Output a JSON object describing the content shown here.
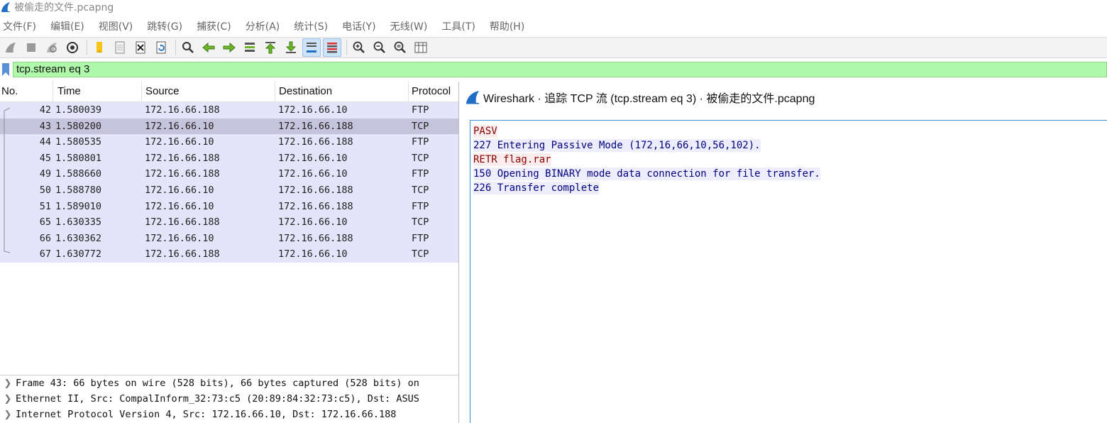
{
  "window": {
    "title": "被偷走的文件.pcapng"
  },
  "menu": [
    "文件(F)",
    "编辑(E)",
    "视图(V)",
    "跳转(G)",
    "捕获(C)",
    "分析(A)",
    "统计(S)",
    "电话(Y)",
    "无线(W)",
    "工具(T)",
    "帮助(H)"
  ],
  "toolbar": {
    "icons": [
      "start-capture-icon",
      "stop-capture-icon",
      "restart-capture-icon",
      "capture-options-icon",
      "open-file-icon",
      "save-file-icon",
      "close-file-icon",
      "reload-file-icon",
      "find-packet-icon",
      "go-back-icon",
      "go-forward-icon",
      "go-to-packet-icon",
      "go-first-icon",
      "go-last-icon",
      "auto-scroll-icon",
      "colorize-icon",
      "zoom-in-icon",
      "zoom-out-icon",
      "zoom-reset-icon",
      "resize-columns-icon"
    ]
  },
  "filter": {
    "value": "tcp.stream eq 3",
    "color": "#aff9aa"
  },
  "packet_list": {
    "columns": [
      "No.",
      "Time",
      "Source",
      "Destination",
      "Protocol"
    ],
    "rows": [
      {
        "no": "42",
        "time": "1.580039",
        "src": "172.16.66.188",
        "dst": "172.16.66.10",
        "proto": "FTP"
      },
      {
        "no": "43",
        "time": "1.580200",
        "src": "172.16.66.10",
        "dst": "172.16.66.188",
        "proto": "TCP"
      },
      {
        "no": "44",
        "time": "1.580535",
        "src": "172.16.66.10",
        "dst": "172.16.66.188",
        "proto": "FTP"
      },
      {
        "no": "45",
        "time": "1.580801",
        "src": "172.16.66.188",
        "dst": "172.16.66.10",
        "proto": "TCP"
      },
      {
        "no": "49",
        "time": "1.588660",
        "src": "172.16.66.188",
        "dst": "172.16.66.10",
        "proto": "FTP"
      },
      {
        "no": "50",
        "time": "1.588780",
        "src": "172.16.66.10",
        "dst": "172.16.66.188",
        "proto": "TCP"
      },
      {
        "no": "51",
        "time": "1.589010",
        "src": "172.16.66.10",
        "dst": "172.16.66.188",
        "proto": "FTP"
      },
      {
        "no": "65",
        "time": "1.630335",
        "src": "172.16.66.188",
        "dst": "172.16.66.10",
        "proto": "TCP"
      },
      {
        "no": "66",
        "time": "1.630362",
        "src": "172.16.66.10",
        "dst": "172.16.66.188",
        "proto": "FTP"
      },
      {
        "no": "67",
        "time": "1.630772",
        "src": "172.16.66.188",
        "dst": "172.16.66.10",
        "proto": "TCP"
      }
    ],
    "row_color": "#e4e4fb",
    "selected_color": "#c6c4dc"
  },
  "details": [
    "Frame 43: 66 bytes on wire (528 bits), 66 bytes captured (528 bits) on",
    "Ethernet II, Src: CompalInform_32:73:c5 (20:89:84:32:73:c5), Dst: ASUS",
    "Internet Protocol Version 4, Src: 172.16.66.10, Dst: 172.16.66.188"
  ],
  "follow_dialog": {
    "title": "Wireshark · 追踪 TCP 流 (tcp.stream eq 3) · 被偷走的文件.pcapng",
    "lines": [
      {
        "dir": "client",
        "text": "PASV"
      },
      {
        "dir": "server",
        "text": "227 Entering Passive Mode (172,16,66,10,56,102)."
      },
      {
        "dir": "client",
        "text": "RETR flag.rar"
      },
      {
        "dir": "server",
        "text": "150 Opening BINARY mode data connection for file transfer."
      },
      {
        "dir": "server",
        "text": "226 Transfer complete"
      }
    ],
    "client_color": "#8b0000",
    "server_color": "#000080"
  }
}
